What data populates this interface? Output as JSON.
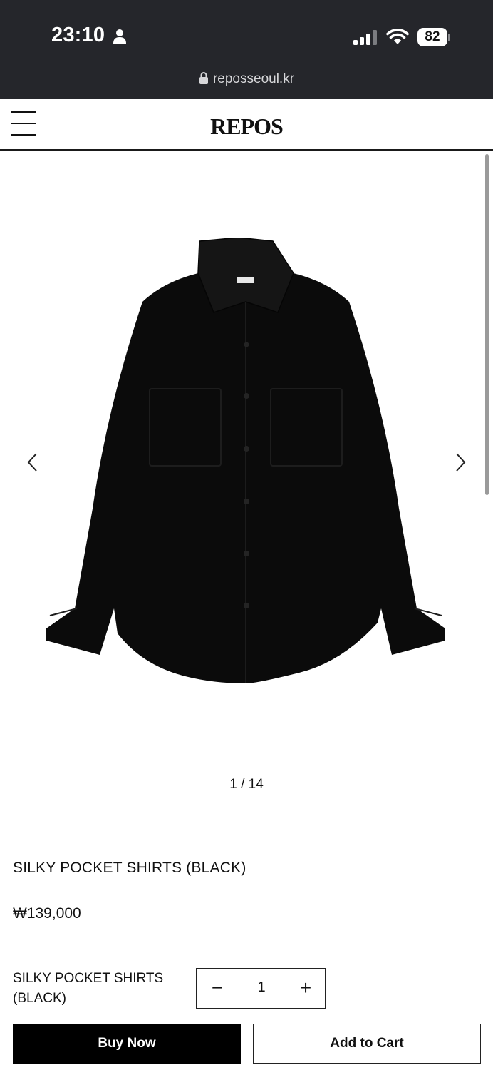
{
  "status_bar": {
    "time": "23:10",
    "battery": "82"
  },
  "browser": {
    "url": "reposseoul.kr"
  },
  "header": {
    "logo": "REPOS"
  },
  "gallery": {
    "counter": "1 / 14",
    "current_index": 1,
    "total": 14
  },
  "product": {
    "title": "SILKY POCKET SHIRTS (BLACK)",
    "price": "₩139,000",
    "option_name": "SILKY POCKET SHIRTS (BLACK)",
    "quantity": "1",
    "minus_label": "−",
    "plus_label": "+"
  },
  "actions": {
    "buy_now": "Buy Now",
    "add_to_cart": "Add to Cart"
  },
  "colors": {
    "status_bar_bg": "#25262b",
    "primary_button_bg": "#000000",
    "text": "#111111"
  }
}
